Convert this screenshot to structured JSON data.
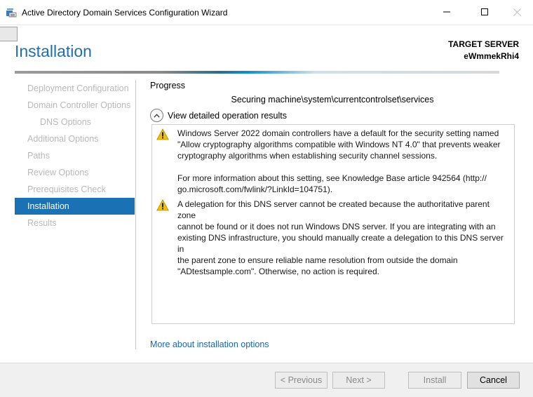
{
  "window": {
    "title": "Active Directory Domain Services Configuration Wizard",
    "app_icon": "ad-ds-icon"
  },
  "header": {
    "title": "Installation",
    "target_label": "TARGET SERVER",
    "target_name": "eWmmekRhi4"
  },
  "nav": {
    "items": [
      {
        "label": "Deployment Configuration",
        "state": "disabled"
      },
      {
        "label": "Domain Controller Options",
        "state": "disabled"
      },
      {
        "label": "DNS Options",
        "state": "disabled"
      },
      {
        "label": "Additional Options",
        "state": "disabled"
      },
      {
        "label": "Paths",
        "state": "disabled"
      },
      {
        "label": "Review Options",
        "state": "disabled"
      },
      {
        "label": "Prerequisites Check",
        "state": "disabled"
      },
      {
        "label": "Installation",
        "state": "active"
      },
      {
        "label": "Results",
        "state": "disabled"
      }
    ]
  },
  "progress": {
    "label": "Progress",
    "status": "Securing machine\\system\\currentcontrolset\\services"
  },
  "details": {
    "toggle_label": "View detailed operation results",
    "messages": [
      {
        "icon": "warning-icon",
        "paragraphs": [
          "Windows Server 2022 domain controllers have a default for the security setting named\n\"Allow cryptography algorithms compatible with Windows NT 4.0\" that prevents weaker\ncryptography algorithms when establishing security channel sessions.",
          "For more information about this setting, see Knowledge Base article 942564 (http://\ngo.microsoft.com/fwlink/?LinkId=104751)."
        ]
      },
      {
        "icon": "warning-icon",
        "paragraphs": [
          "A delegation for this DNS server cannot be created because the authoritative parent zone\ncannot be found or it does not run Windows DNS server. If you are integrating with an\nexisting DNS infrastructure, you should manually create a delegation to this DNS server in\nthe parent zone to ensure reliable name resolution from outside the domain\n\"ADtestsample.com\". Otherwise, no action is required."
        ]
      }
    ]
  },
  "more_link": "More about installation options",
  "footer": {
    "previous": "< Previous",
    "next": "Next >",
    "install": "Install",
    "cancel": "Cancel"
  },
  "colors": {
    "accent": "#1a72b5",
    "title_blue": "#1f6fad",
    "link": "#1a66b0",
    "nav_disabled": "#b9b9b9",
    "warning": "#f2c200"
  }
}
